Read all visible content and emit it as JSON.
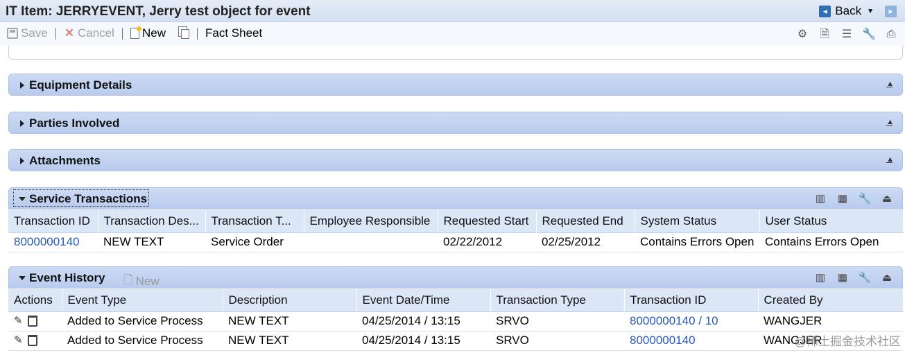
{
  "window": {
    "title": "IT Item: JERRYEVENT, Jerry test object for event",
    "back_label": "Back"
  },
  "toolbar": {
    "save_label": "Save",
    "cancel_label": "Cancel",
    "new_label": "New",
    "fact_sheet_label": "Fact Sheet",
    "right_icons": [
      "gear-icon",
      "document-settings-icon",
      "list-icon",
      "wrench-icon",
      "printer-icon"
    ]
  },
  "sections": {
    "equipment": "Equipment Details",
    "parties": "Parties Involved",
    "attachments": "Attachments"
  },
  "service_transactions": {
    "title": "Service Transactions",
    "columns": [
      "Transaction ID",
      "Transaction Des...",
      "Transaction T...",
      "Employee Responsible",
      "Requested Start",
      "Requested End",
      "System Status",
      "User Status"
    ],
    "rows": [
      {
        "transaction_id": "8000000140",
        "description": "NEW TEXT",
        "type": "Service Order",
        "employee": "",
        "start": "02/22/2012",
        "end": "02/25/2012",
        "system_status": "Contains Errors Open",
        "user_status": "Contains Errors Open"
      }
    ]
  },
  "event_history": {
    "title": "Event History",
    "new_label": "New",
    "columns": [
      "Actions",
      "Event Type",
      "Description",
      "Event Date/Time",
      "Transaction Type",
      "Transaction ID",
      "Created By"
    ],
    "rows": [
      {
        "event_type": "Added to Service Process",
        "description": "NEW TEXT",
        "datetime": "04/25/2014 / 13:15",
        "transaction_type": "SRVO",
        "transaction_id": "8000000140 / 10",
        "created_by": "WANGJER"
      },
      {
        "event_type": "Added to Service Process",
        "description": "NEW TEXT",
        "datetime": "04/25/2014 / 13:15",
        "transaction_type": "SRVO",
        "transaction_id": "8000000140",
        "created_by": "WANGJER"
      }
    ]
  },
  "watermark": "@稀土掘金技术社区",
  "colors": {
    "section_bar": "#c3d3f1",
    "header_row": "#dbe7f7",
    "link": "#2859b8"
  }
}
